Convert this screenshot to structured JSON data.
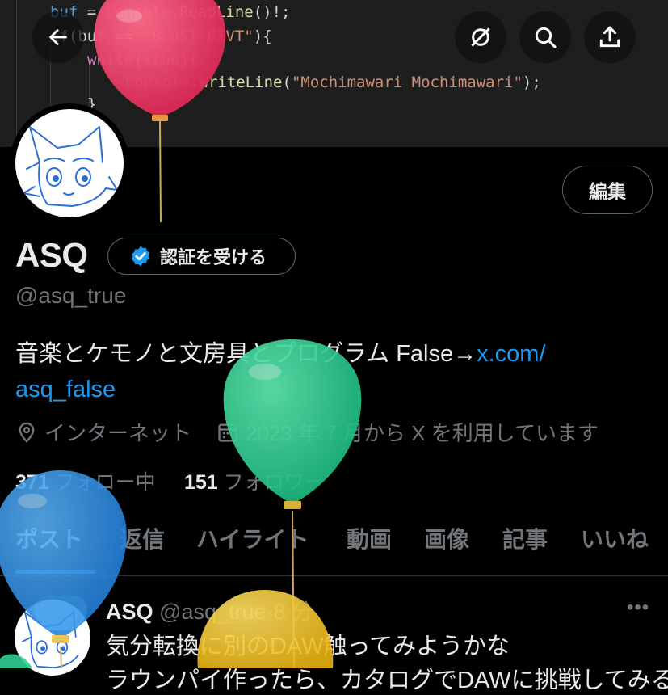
{
  "banner": {
    "code_lines": [
      {
        "parts": [
          {
            "t": "buf",
            "c": "kw"
          },
          {
            "t": " = ",
            "c": "pl"
          },
          {
            "t": "Console",
            "c": "ty"
          },
          {
            "t": ".",
            "c": "pl"
          },
          {
            "t": "ReadLine",
            "c": "fn"
          },
          {
            "t": "()!;",
            "c": "pl"
          }
        ]
      },
      {
        "parts": [
          {
            "t": "if",
            "c": "ctl"
          },
          {
            "t": "(buf == ",
            "c": "pl"
          },
          {
            "t": "\"BLVST BEVT\"",
            "c": "str"
          },
          {
            "t": "){",
            "c": "pl"
          }
        ]
      },
      {
        "parts": [
          {
            "t": "while",
            "c": "ctl"
          },
          {
            "t": "(",
            "c": "pl"
          },
          {
            "t": "true",
            "c": "kw"
          },
          {
            "t": "){",
            "c": "pl"
          }
        ]
      },
      {
        "parts": [
          {
            "t": "Console",
            "c": "ty"
          },
          {
            "t": ".",
            "c": "pl"
          },
          {
            "t": "WriteLine",
            "c": "fn"
          },
          {
            "t": "(",
            "c": "pl"
          },
          {
            "t": "\"Mochimawari Mochimawari\"",
            "c": "str"
          },
          {
            "t": ");",
            "c": "pl"
          }
        ]
      },
      {
        "parts": [
          {
            "t": "}",
            "c": "pl"
          }
        ]
      }
    ]
  },
  "top_buttons": {
    "back": "back-arrow-icon",
    "grok": "grok-icon",
    "search": "search-icon",
    "share": "share-icon"
  },
  "profile": {
    "edit_label": "編集",
    "name": "ASQ",
    "verify_label": "認証を受ける",
    "handle": "@asq_true",
    "bio_text": "音楽とケモノと文房具とプログラム False→",
    "bio_link_1": "x.com/",
    "bio_link_2": "asq_false",
    "location": "インターネット",
    "joined": "2023 年 7 月から X を利用しています",
    "following_count": "371",
    "following_label": "フォロー中",
    "followers_count": "151",
    "followers_label": "フォロワー"
  },
  "tabs": [
    "ポスト",
    "返信",
    "ハイライト",
    "動画",
    "画像",
    "記事",
    "いいね"
  ],
  "active_tab": "ポスト",
  "post": {
    "author": "ASQ",
    "handle": "@asq_true",
    "time": "8 分",
    "more": "•••",
    "text": "気分転換に別のDAW触ってみようかな",
    "text2": "ラウンパイ作ったら、カタログでDAWに挑戦してみる"
  },
  "colors": {
    "accent": "#1d9bf0",
    "balloon_red": "#e8335e",
    "balloon_green": "#2ecf8f",
    "balloon_blue": "#2f8fe6",
    "balloon_yellow": "#f5c624"
  }
}
